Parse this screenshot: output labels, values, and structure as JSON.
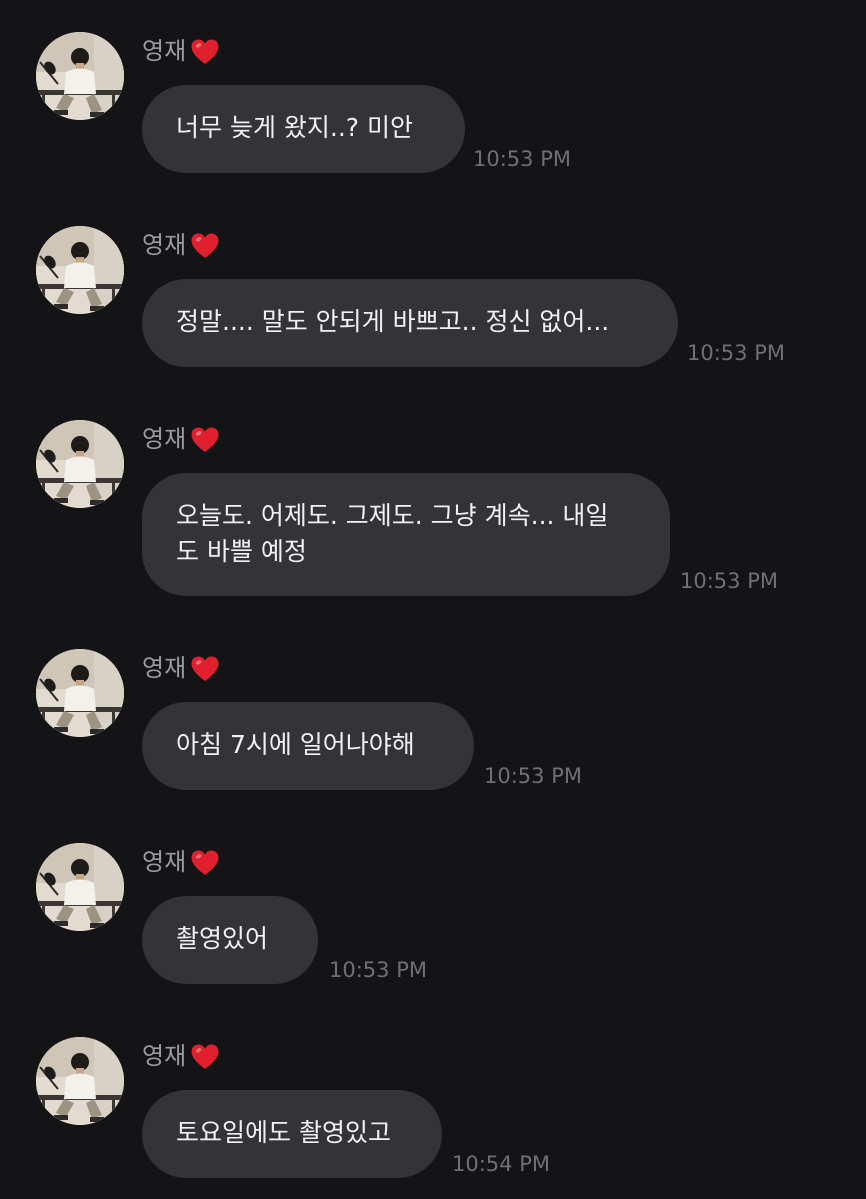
{
  "sender": {
    "name": "영재",
    "badge_icon": "heart-icon",
    "badge_color": "#e0202e"
  },
  "messages": [
    {
      "text": "너무 늦게 왔지..? 미안",
      "time": "10:53 PM"
    },
    {
      "text": "정말.... 말도 안되게 바쁘고.. 정신 없어...",
      "time": "10:53 PM"
    },
    {
      "text": "오늘도. 어제도. 그제도. 그냥 계속... 내일\n도 바쁠 예정",
      "time": "10:53 PM"
    },
    {
      "text": "아침 7시에 일어나야해",
      "time": "10:53 PM"
    },
    {
      "text": "촬영있어",
      "time": "10:53 PM"
    },
    {
      "text": "토요일에도 촬영있고",
      "time": "10:54 PM"
    }
  ]
}
